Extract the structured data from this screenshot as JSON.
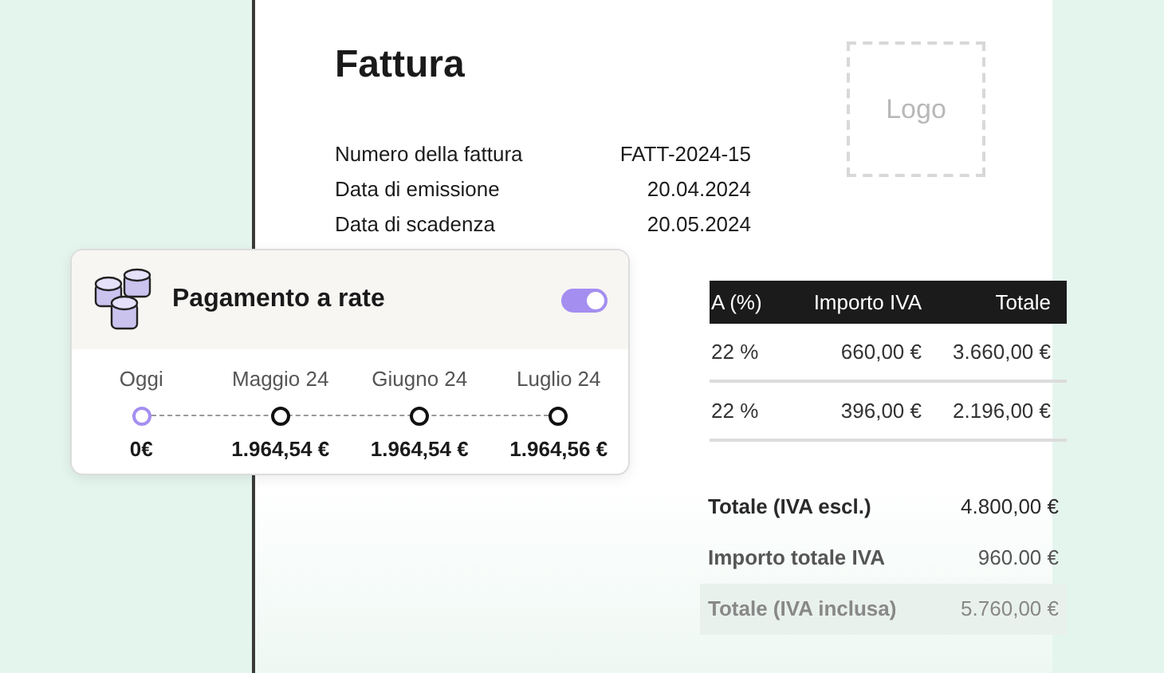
{
  "invoice": {
    "title": "Fattura",
    "logo_placeholder": "Logo",
    "details": [
      {
        "label": "Numero della fattura",
        "value": "FATT-2024-15"
      },
      {
        "label": "Data di emissione",
        "value": "20.04.2024"
      },
      {
        "label": "Data di scadenza",
        "value": "20.05.2024"
      }
    ],
    "table": {
      "columns": [
        "A (%)",
        "Importo IVA",
        "Totale"
      ],
      "rows": [
        [
          "22 %",
          "660,00 €",
          "3.660,00 €"
        ],
        [
          "22 %",
          "396,00 €",
          "2.196,00 €"
        ]
      ]
    },
    "totals": [
      {
        "label": "Totale (IVA escl.)",
        "value": "4.800,00 €",
        "highlighted": false
      },
      {
        "label": "Importo totale IVA",
        "value": "960.00 €",
        "highlighted": false
      },
      {
        "label": "Totale (IVA inclusa)",
        "value": "5.760,00 €",
        "highlighted": true
      }
    ]
  },
  "installments_card": {
    "title": "Pagamento a rate",
    "on": true,
    "steps": [
      {
        "label": "Oggi",
        "amount": "0€",
        "current": true
      },
      {
        "label": "Maggio 24",
        "amount": "1.964,54 €",
        "current": false
      },
      {
        "label": "Giugno 24",
        "amount": "1.964,54 €",
        "current": false
      },
      {
        "label": "Luglio 24",
        "amount": "1.964,56 €",
        "current": false
      }
    ]
  }
}
